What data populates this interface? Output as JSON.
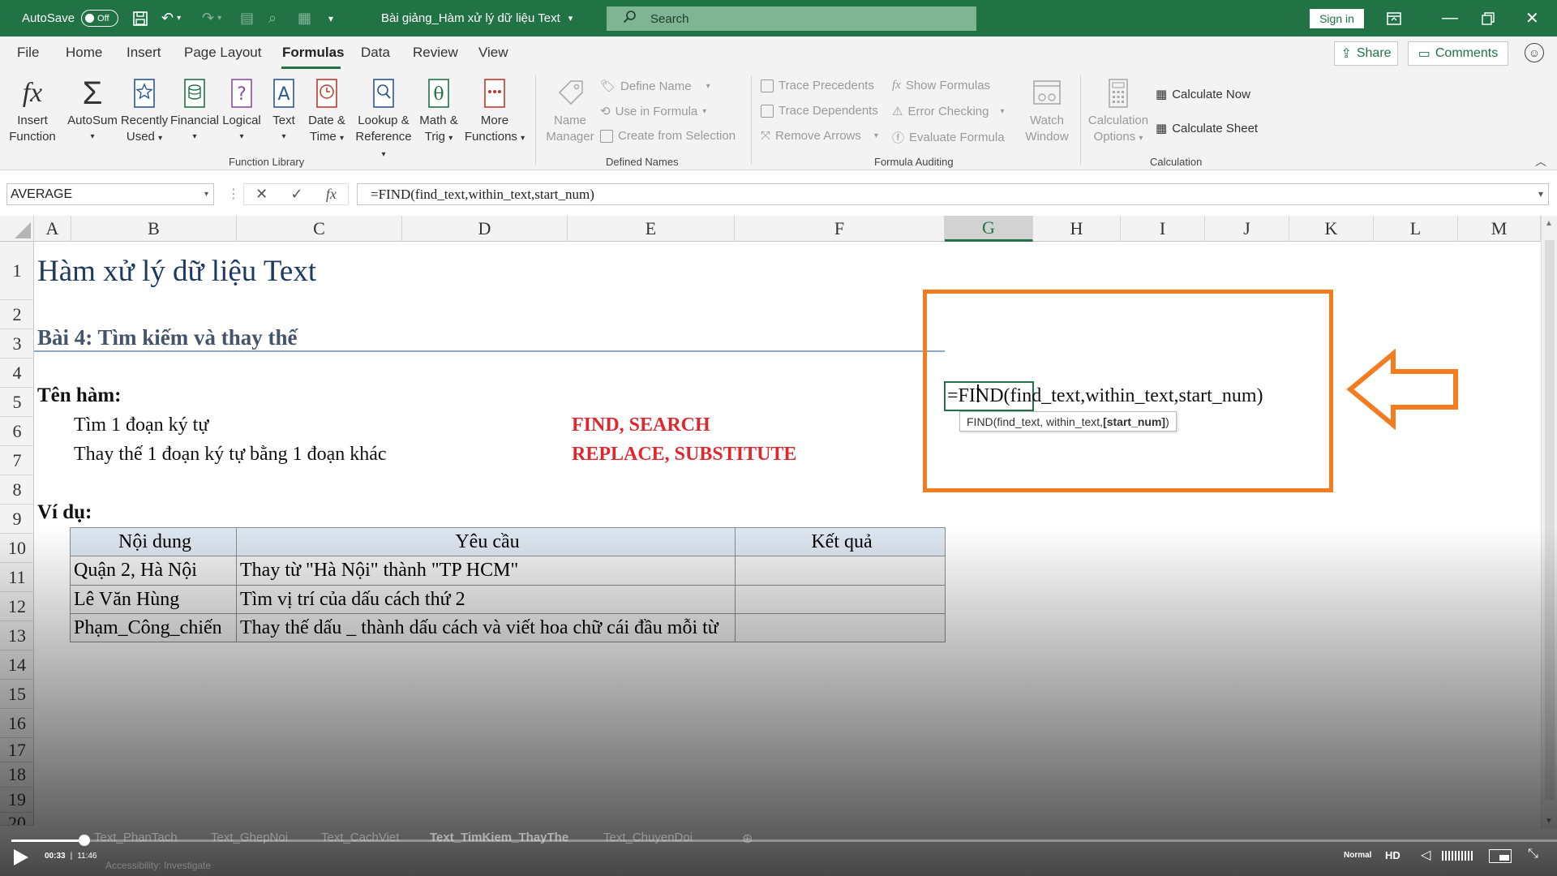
{
  "titlebar": {
    "autosave_label": "AutoSave",
    "autosave_state": "Off",
    "doc_title": "Bài giảng_Hàm xử lý dữ liệu Text",
    "search_placeholder": "Search",
    "signin_label": "Sign in"
  },
  "menu": {
    "tabs": [
      "File",
      "Home",
      "Insert",
      "Page Layout",
      "Formulas",
      "Data",
      "Review",
      "View"
    ],
    "active": "Formulas",
    "share_label": "Share",
    "comments_label": "Comments"
  },
  "ribbon": {
    "insert_function": [
      "Insert",
      "Function"
    ],
    "autosum": [
      "AutoSum",
      ""
    ],
    "recently_used": [
      "Recently",
      "Used"
    ],
    "financial": [
      "Financial",
      ""
    ],
    "logical": [
      "Logical",
      ""
    ],
    "text": [
      "Text",
      ""
    ],
    "datetime": [
      "Date &",
      "Time"
    ],
    "lookup": [
      "Lookup &",
      "Reference"
    ],
    "math": [
      "Math &",
      "Trig"
    ],
    "more": [
      "More",
      "Functions"
    ],
    "function_library_label": "Function Library",
    "name_manager": [
      "Name",
      "Manager"
    ],
    "define_name": "Define Name",
    "use_in_formula": "Use in Formula",
    "create_from_selection": "Create from Selection",
    "defined_names_label": "Defined Names",
    "trace_precedents": "Trace Precedents",
    "trace_dependents": "Trace Dependents",
    "remove_arrows": "Remove Arrows",
    "show_formulas": "Show Formulas",
    "error_checking": "Error Checking",
    "evaluate_formula": "Evaluate Formula",
    "watch_window": [
      "Watch",
      "Window"
    ],
    "formula_auditing_label": "Formula Auditing",
    "calc_options": [
      "Calculation",
      "Options"
    ],
    "calculate_now": "Calculate Now",
    "calculate_sheet": "Calculate Sheet",
    "calculation_label": "Calculation"
  },
  "formula_bar": {
    "name_box": "AVERAGE",
    "formula": "=FIND(find_text,within_text,start_num)"
  },
  "columns": [
    "A",
    "B",
    "C",
    "D",
    "E",
    "F",
    "G",
    "H",
    "I",
    "J",
    "K",
    "L",
    "M"
  ],
  "rows": [
    "1",
    "2",
    "3",
    "4",
    "5",
    "6",
    "7",
    "8",
    "9",
    "10",
    "11",
    "12",
    "13",
    "14",
    "15",
    "16",
    "17",
    "18",
    "19",
    "20"
  ],
  "sheet": {
    "title": "Hàm xử lý dữ liệu Text",
    "lesson": "Bài 4: Tìm kiếm và thay thế",
    "func_name_label": "Tên hàm:",
    "task1": "Tìm 1 đoạn ký tự",
    "task1_funcs": "FIND, SEARCH",
    "task2": "Thay thế 1 đoạn ký tự bằng 1 đoạn khác",
    "task2_funcs": "REPLACE, SUBSTITUTE",
    "example_label": "Ví dụ:",
    "table": {
      "headers": [
        "Nội dung",
        "Yêu cầu",
        "Kết quả"
      ],
      "rows": [
        [
          "Quận 2, Hà Nội",
          "Thay từ \"Hà Nội\" thành \"TP HCM\"",
          ""
        ],
        [
          "Lê Văn Hùng",
          "Tìm vị trí của dấu cách thứ 2",
          ""
        ],
        [
          "Phạm_Công_chiến",
          "Thay thế dấu _ thành dấu cách và viết hoa chữ cái đầu mỗi từ",
          ""
        ]
      ]
    },
    "active_cell_formula_eq": "=",
    "active_cell_formula_rest": "FIND(find_text,within_text,start_num)",
    "tooltip_prefix": "FIND(find_text, within_text, ",
    "tooltip_bold": "[start_num]",
    "tooltip_suffix": ")"
  },
  "sheet_tabs": [
    "Text_PhanTach",
    "Text_GhepNoi",
    "Text_CachViet",
    "Text_TimKiem_ThayThe",
    "Text_ChuyenDoi"
  ],
  "status": {
    "accessibility": "Accessibility: Investigate"
  },
  "video": {
    "time_current": "00:33",
    "time_total": "11:46",
    "speed": "Normal",
    "quality": "HD",
    "progress": 0.047
  },
  "colors": {
    "excel_green": "#217346",
    "highlight_orange": "#f47c20",
    "red_text": "#e0272d",
    "table_header": "#dce6f1",
    "table_body": "#f2f2f2"
  }
}
